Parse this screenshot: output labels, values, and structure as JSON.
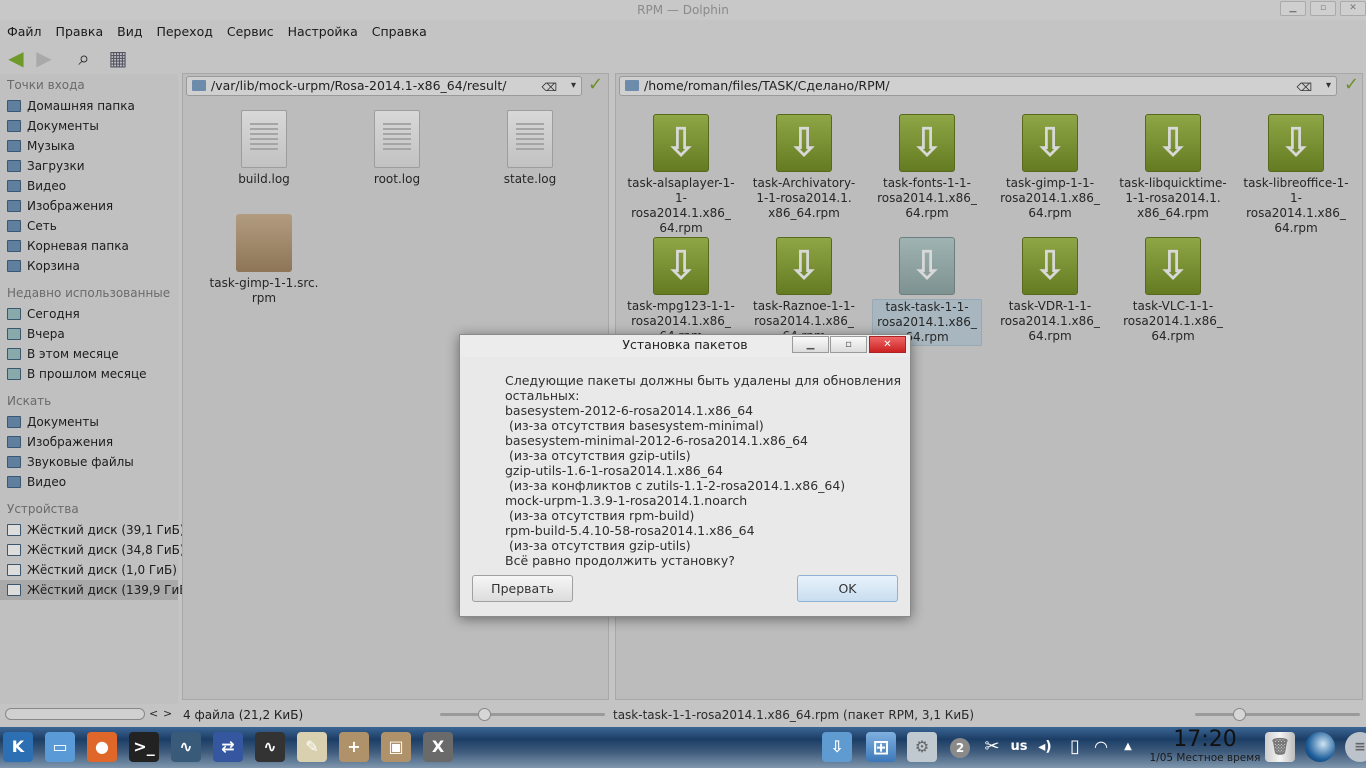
{
  "window": {
    "title": "RPM — Dolphin",
    "min": "▁",
    "max": "▫",
    "close": "✕"
  },
  "menu": [
    "Файл",
    "Правка",
    "Вид",
    "Переход",
    "Сервис",
    "Настройка",
    "Справка"
  ],
  "toolbar": {
    "back": "◀",
    "forward": "▶",
    "search": "⌕",
    "view": "▦"
  },
  "sidebar": {
    "places_title": "Точки входа",
    "places": [
      "Домашняя папка",
      "Документы",
      "Музыка",
      "Загрузки",
      "Видео",
      "Изображения",
      "Сеть",
      "Корневая папка",
      "Корзина"
    ],
    "recent_title": "Недавно использованные",
    "recent": [
      "Сегодня",
      "Вчера",
      "В этом месяце",
      "В прошлом месяце"
    ],
    "search_title": "Искать",
    "search": [
      "Документы",
      "Изображения",
      "Звуковые файлы",
      "Видео"
    ],
    "devices_title": "Устройства",
    "devices": [
      "Жёсткий диск (39,1 ГиБ)",
      "Жёсткий диск (34,8 ГиБ)",
      "Жёсткий диск (1,0 ГиБ)",
      "Жёсткий диск (139,9 ГиБ)"
    ]
  },
  "left_pane": {
    "path": "/var/lib/mock-urpm/Rosa-2014.1-x86_64/result/",
    "files": [
      {
        "name": "build.log",
        "type": "log"
      },
      {
        "name": "root.log",
        "type": "log"
      },
      {
        "name": "state.log",
        "type": "log"
      },
      {
        "name": "task-gimp-1-1.src.\nrpm",
        "type": "package"
      }
    ]
  },
  "right_pane": {
    "path": "/home/roman/files/TASK/Сделано/RPM/",
    "files": [
      {
        "name": "task-alsaplayer-1-\n1-rosa2014.1.x86_\n64.rpm"
      },
      {
        "name": "task-Archivatory-\n1-1-rosa2014.1.\nx86_64.rpm"
      },
      {
        "name": "task-fonts-1-1-\nrosa2014.1.x86_\n64.rpm"
      },
      {
        "name": "task-gimp-1-1-\nrosa2014.1.x86_\n64.rpm"
      },
      {
        "name": "task-libquicktime-\n1-1-rosa2014.1.\nx86_64.rpm"
      },
      {
        "name": "task-libreoffice-1-\n1-rosa2014.1.x86_\n64.rpm"
      },
      {
        "name": "task-mpg123-1-1-\nrosa2014.1.x86_\n64.rpm"
      },
      {
        "name": "task-Raznoe-1-1-\nrosa2014.1.x86_\n64.rpm"
      },
      {
        "name": "task-task-1-1-\nrosa2014.1.x86_\n64.rpm",
        "selected": true
      },
      {
        "name": "task-VDR-1-1-\nrosa2014.1.x86_\n64.rpm"
      },
      {
        "name": "task-VLC-1-1-\nrosa2014.1.x86_\n64.rpm"
      }
    ]
  },
  "status": {
    "left": "4 файла (21,2 КиБ)",
    "right": "task-task-1-1-rosa2014.1.x86_64.rpm (пакет RPM, 3,1 КиБ)"
  },
  "dialog": {
    "title": "Установка пакетов",
    "message": "Следующие пакеты должны быть удалены для обновления\nостальных:\nbasesystem-2012-6-rosa2014.1.x86_64\n (из-за отсутствия basesystem-minimal)\nbasesystem-minimal-2012-6-rosa2014.1.x86_64\n (из-за отсутствия gzip-utils)\ngzip-utils-1.6-1-rosa2014.1.x86_64\n (из-за конфликтов с zutils-1.1-2-rosa2014.1.x86_64)\nmock-urpm-1.3.9-1-rosa2014.1.noarch\n (из-за отсутствия rpm-build)\nrpm-build-5.4.10-58-rosa2014.1.x86_64\n (из-за отсутствия gzip-utils)\nВсё равно продолжить установку?",
    "cancel": "Прервать",
    "ok": "OK",
    "min": "▁",
    "max": "▫",
    "close": "✕"
  },
  "taskbar": {
    "launchers": [
      {
        "icon": "kde-menu-icon",
        "glyph": "K",
        "color": "#2d6fb3"
      },
      {
        "icon": "file-manager-icon",
        "glyph": "▭",
        "color": "#5a9ad6"
      },
      {
        "icon": "firefox-icon",
        "glyph": "●",
        "color": "#e0672a"
      },
      {
        "icon": "terminal-icon",
        "glyph": ">_",
        "color": "#222"
      },
      {
        "icon": "system-monitor-icon",
        "glyph": "∿",
        "color": "#3a5a7a"
      },
      {
        "icon": "network-icon",
        "glyph": "⇄",
        "color": "#3557a0"
      },
      {
        "icon": "ksysguard-icon",
        "glyph": "∿",
        "color": "#333"
      },
      {
        "icon": "notes-icon",
        "glyph": "✎",
        "color": "#d9d0b0"
      },
      {
        "icon": "package-install-icon",
        "glyph": "+",
        "color": "#b0926a"
      },
      {
        "icon": "package-icon",
        "glyph": "▣",
        "color": "#b0926a"
      },
      {
        "icon": "x-tool-icon",
        "glyph": "X",
        "color": "#6a6a6a"
      }
    ],
    "tray": {
      "desktop_badge": "2",
      "keyboard": "us",
      "time": "17:20",
      "date": "1/05 Местное время"
    }
  }
}
